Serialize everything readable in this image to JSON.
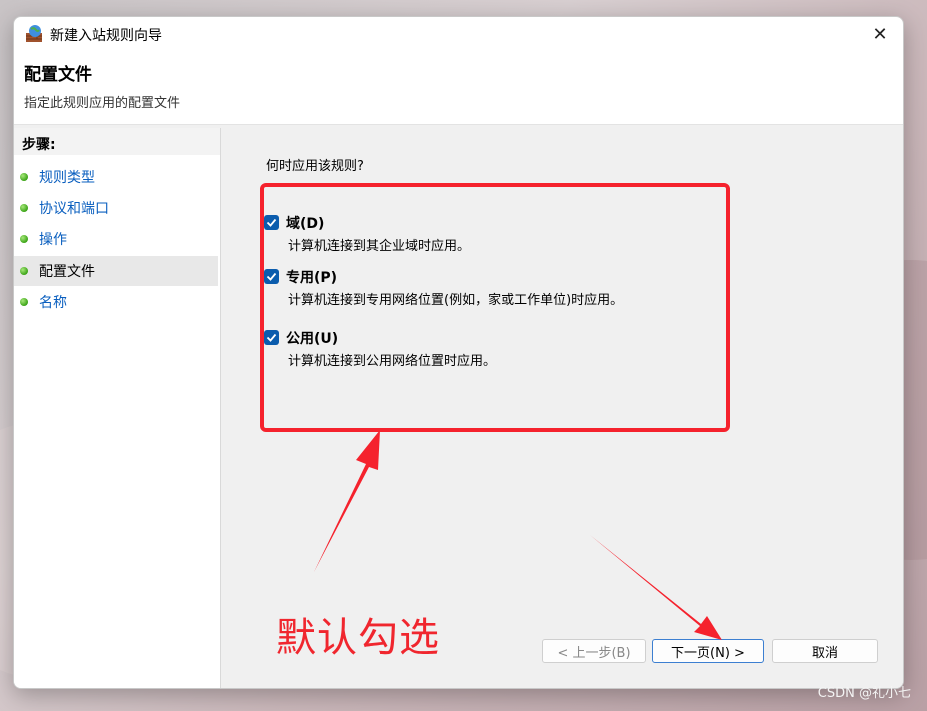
{
  "window": {
    "title": "新建入站规则向导",
    "close_glyph": "✕"
  },
  "header": {
    "title": "配置文件",
    "subtitle": "指定此规则应用的配置文件"
  },
  "steps": {
    "heading": "步骤:",
    "items": [
      {
        "label": "规则类型",
        "active": false
      },
      {
        "label": "协议和端口",
        "active": false
      },
      {
        "label": "操作",
        "active": false
      },
      {
        "label": "配置文件",
        "active": true
      },
      {
        "label": "名称",
        "active": false
      }
    ]
  },
  "content": {
    "question": "何时应用该规则?",
    "options": [
      {
        "title": "域(D)",
        "desc": "计算机连接到其企业域时应用。",
        "checked": true
      },
      {
        "title": "专用(P)",
        "desc": "计算机连接到专用网络位置(例如，家或工作单位)时应用。",
        "checked": true
      },
      {
        "title": "公用(U)",
        "desc": "计算机连接到公用网络位置时应用。",
        "checked": true
      }
    ]
  },
  "annotation": {
    "text": "默认勾选",
    "color": "#f0262e"
  },
  "buttons": {
    "back": "< 上一步(B)",
    "next": "下一页(N) >",
    "cancel": "取消"
  },
  "watermark": "CSDN @礼小七",
  "colors": {
    "accent": "#0b5cad",
    "link": "#0a5fbf",
    "annotation_red": "#f5222d"
  }
}
